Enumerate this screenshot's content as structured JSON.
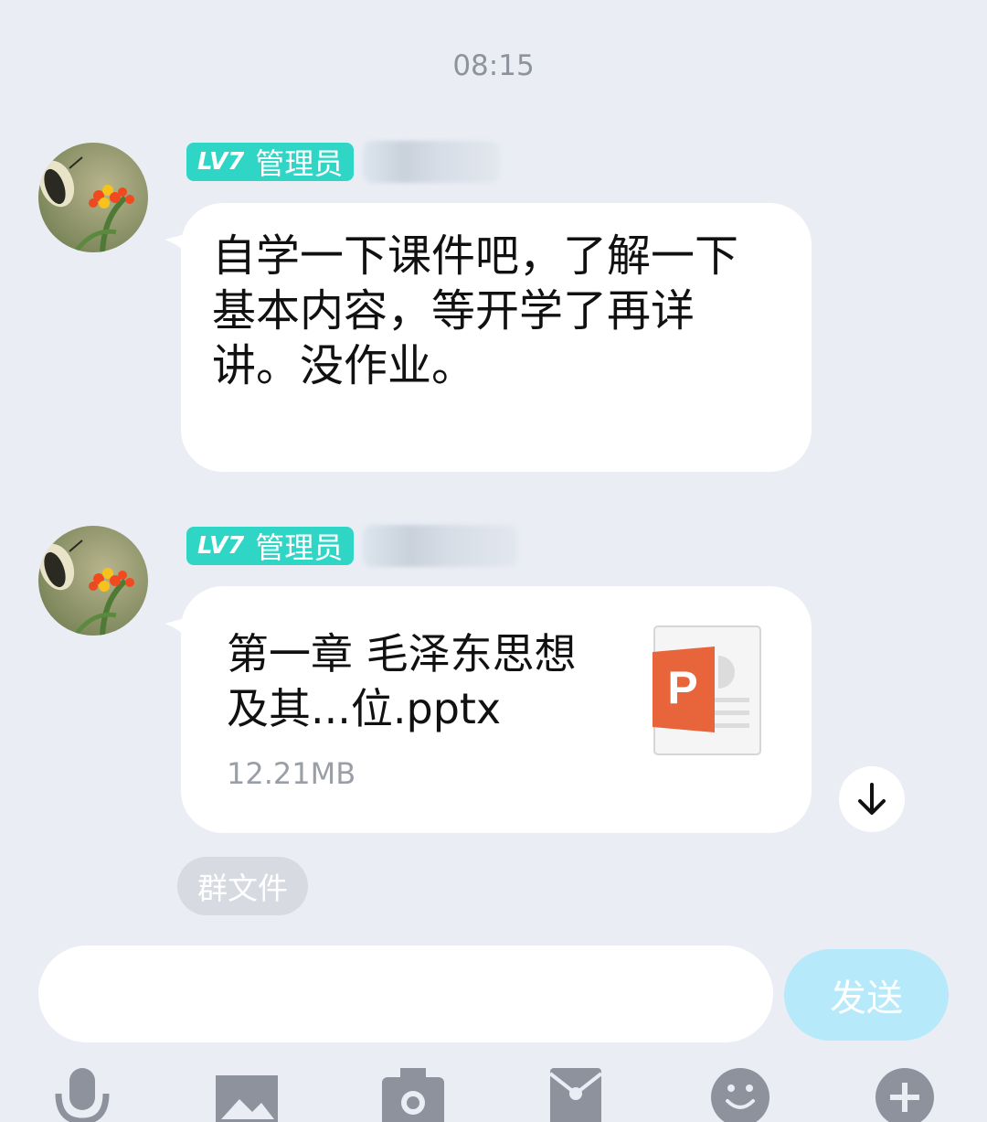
{
  "chat": {
    "timestamp": "08:15",
    "messages": [
      {
        "sender_level": "LV7",
        "sender_role": "管理员",
        "text": "自学一下课件吧，了解一下基本内容，等开学了再详讲。没作业。"
      },
      {
        "sender_level": "LV7",
        "sender_role": "管理员",
        "file": {
          "name": "第一章 毛泽东思想及其...位.pptx",
          "size": "12.21MB",
          "icon": "powerpoint-file-icon",
          "icon_letter": "P"
        }
      }
    ],
    "group_file_tag": "群文件"
  },
  "composer": {
    "input_value": "",
    "send_label": "发送"
  },
  "toolbar": {
    "items": [
      "microphone-icon",
      "image-icon",
      "camera-icon",
      "red-packet-icon",
      "emoji-icon",
      "plus-icon"
    ]
  },
  "colors": {
    "background": "#ebedf5",
    "badge": "#2fd6c6",
    "send_button": "#b6e9fa",
    "ppt_orange": "#e8643a",
    "toolbar_icon": "#8d929c"
  }
}
